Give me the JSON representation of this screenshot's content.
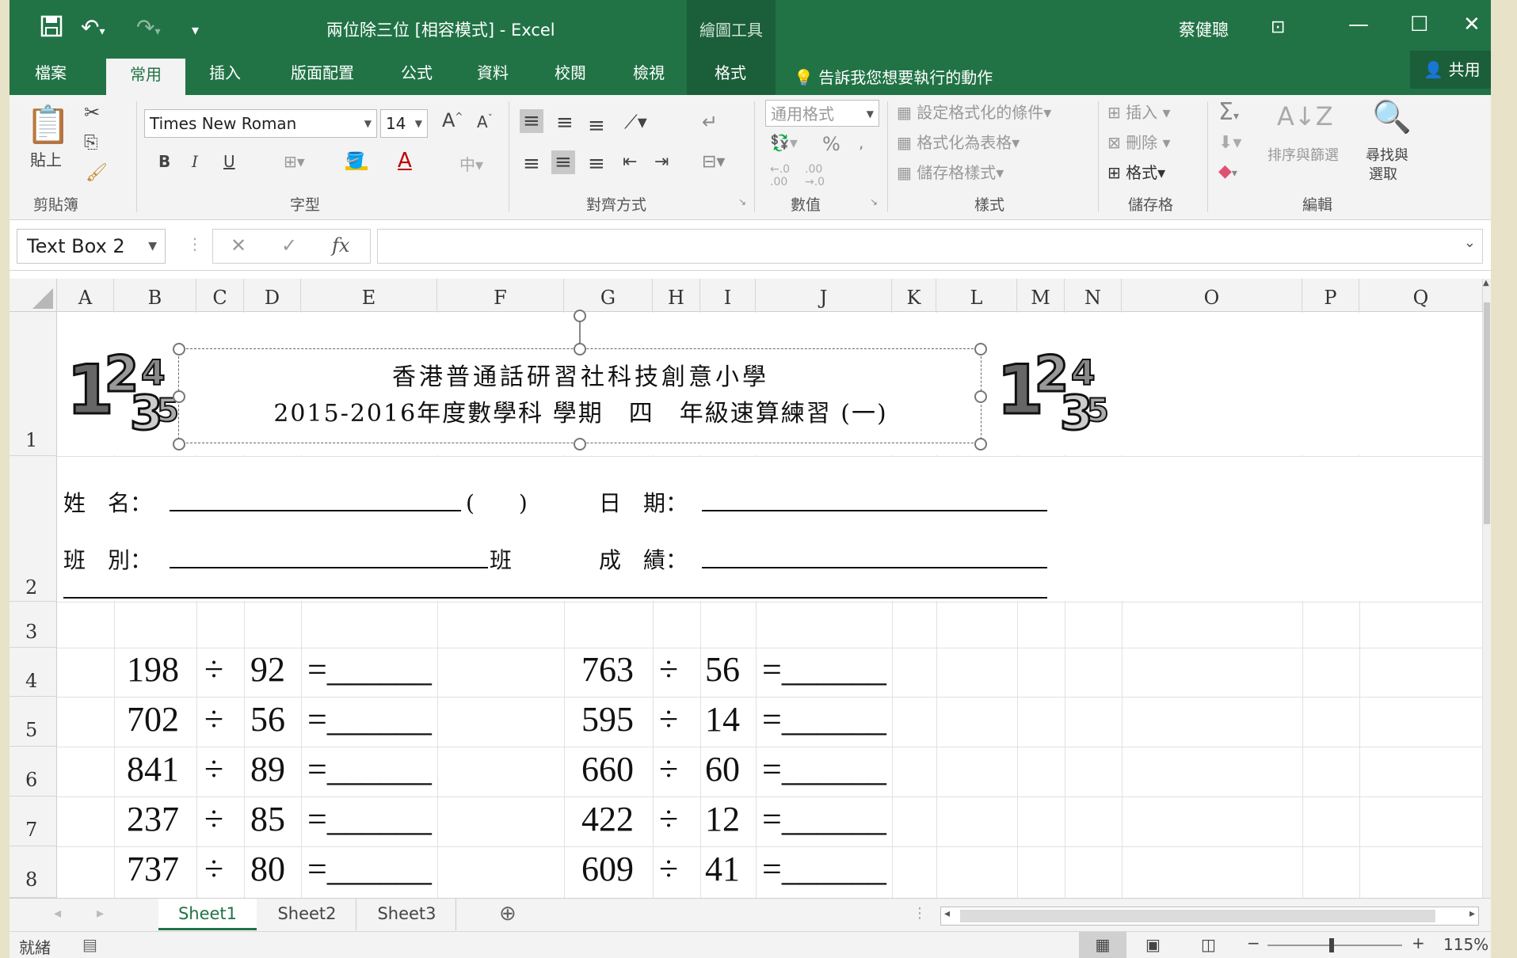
{
  "window": {
    "doc_title": "兩位除三位 [相容模式] - Excel",
    "context_tool": "繪圖工具",
    "user": "蔡健聰"
  },
  "tabs": [
    "檔案",
    "常用",
    "插入",
    "版面配置",
    "公式",
    "資料",
    "校閱",
    "檢視",
    "格式"
  ],
  "tell_me": "告訴我您想要執行的動作",
  "share": "共用",
  "ribbon": {
    "clipboard": {
      "paste": "貼上",
      "group": "剪貼簿"
    },
    "font": {
      "name": "Times New Roman",
      "size": "14",
      "bold": "B",
      "italic": "I",
      "underline": "U",
      "group": "字型"
    },
    "alignment": {
      "group": "對齊方式"
    },
    "number": {
      "format": "通用格式",
      "percent": "%",
      "group": "數值"
    },
    "styles": {
      "conditional": "設定格式化的條件",
      "as_table": "格式化為表格",
      "cell_styles": "儲存格樣式",
      "group": "樣式"
    },
    "cells": {
      "insert": "插入",
      "delete": "刪除",
      "format": "格式",
      "group": "儲存格"
    },
    "editing": {
      "sort_filter": "排序與篩選",
      "find_1": "尋找與",
      "find_2": "選取",
      "group": "編輯"
    }
  },
  "formula_bar": {
    "name_box": "Text Box 2",
    "fx": "fx",
    "value": ""
  },
  "columns": [
    "A",
    "B",
    "C",
    "D",
    "E",
    "F",
    "G",
    "H",
    "I",
    "J",
    "K",
    "L",
    "M",
    "N",
    "O",
    "P",
    "Q"
  ],
  "rows": [
    "1",
    "2",
    "3",
    "4",
    "5",
    "6",
    "7",
    "8"
  ],
  "worksheet": {
    "title_line1": "香港普通話研習社科技創意小學",
    "title_line2": "2015-2016年度數學科 學期　四　年級速算練習 (一)",
    "name_label": "姓　名：",
    "paren": "(　　)",
    "date_label": "日　期：",
    "class_label": "班　別：",
    "class_suffix": "班",
    "score_label": "成　績：",
    "problems_left": [
      {
        "a": "198",
        "op": "÷",
        "b": "92",
        "eq": "=______"
      },
      {
        "a": "702",
        "op": "÷",
        "b": "56",
        "eq": "=______"
      },
      {
        "a": "841",
        "op": "÷",
        "b": "89",
        "eq": "=______"
      },
      {
        "a": "237",
        "op": "÷",
        "b": "85",
        "eq": "=______"
      },
      {
        "a": "737",
        "op": "÷",
        "b": "80",
        "eq": "=______"
      }
    ],
    "problems_right": [
      {
        "a": "763",
        "op": "÷",
        "b": "56",
        "eq": "=______"
      },
      {
        "a": "595",
        "op": "÷",
        "b": "14",
        "eq": "=______"
      },
      {
        "a": "660",
        "op": "÷",
        "b": "60",
        "eq": "=______"
      },
      {
        "a": "422",
        "op": "÷",
        "b": "12",
        "eq": "=______"
      },
      {
        "a": "609",
        "op": "÷",
        "b": "41",
        "eq": "=______"
      }
    ]
  },
  "sheet_tabs": [
    "Sheet1",
    "Sheet2",
    "Sheet3"
  ],
  "status": {
    "ready": "就緒",
    "zoom": "115%"
  },
  "colors": {
    "excel_green": "#217346",
    "ribbon_bg": "#f3f3f3"
  }
}
